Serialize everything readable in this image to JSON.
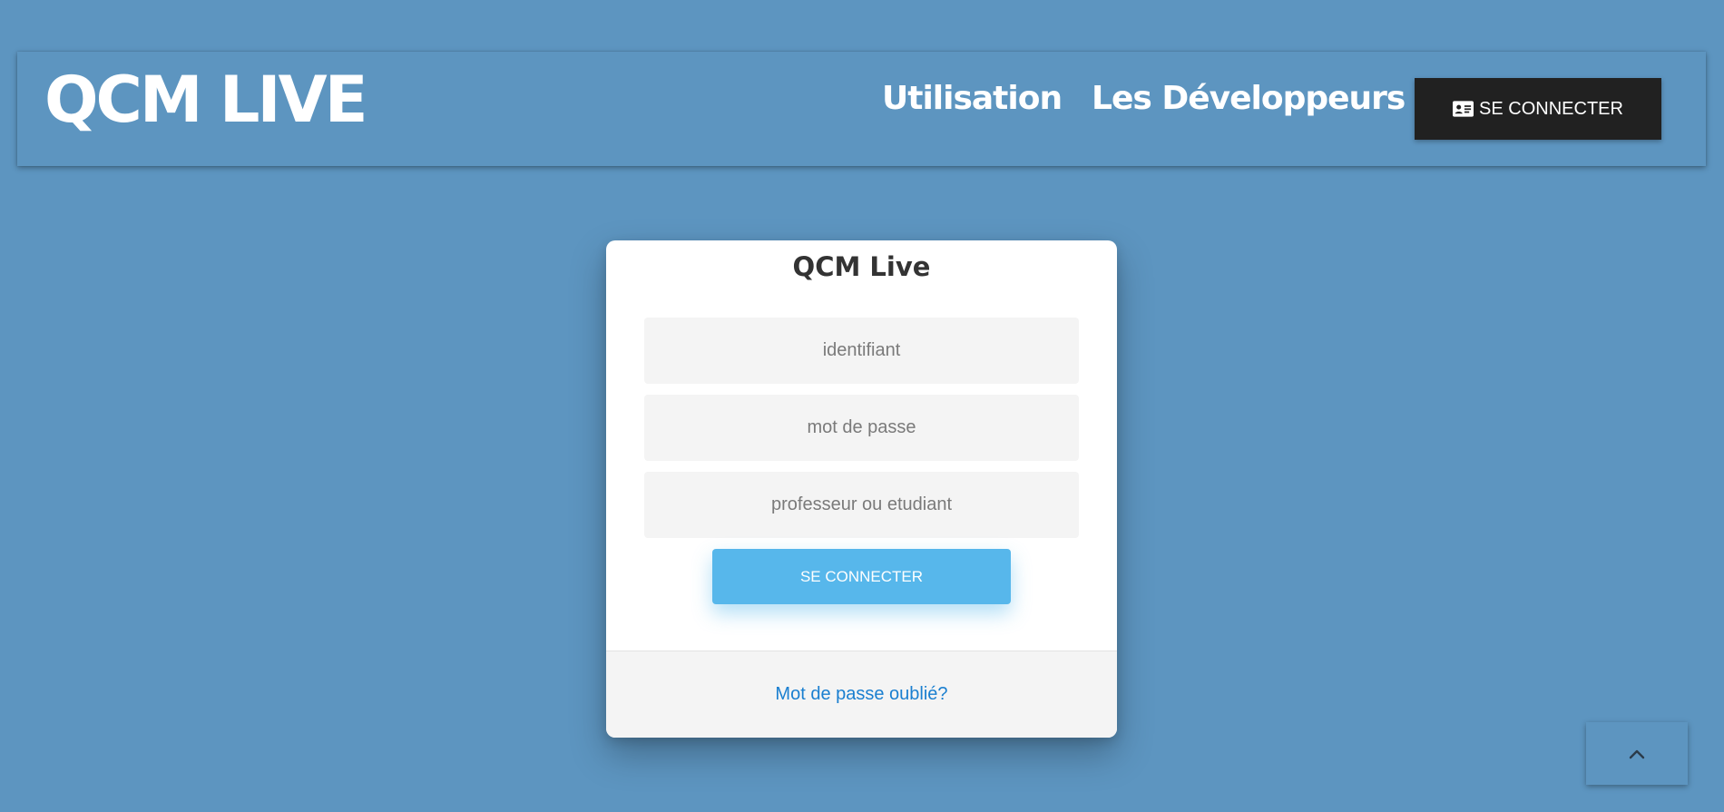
{
  "header": {
    "brand": "QCM LIVE",
    "nav": [
      {
        "label": "Utilisation"
      },
      {
        "label": "Les Développeurs"
      }
    ],
    "login_button": {
      "icon": "id-card-icon",
      "label": "SE CONNECTER"
    }
  },
  "login_card": {
    "title": "QCM Live",
    "fields": {
      "identifier_placeholder": "identifiant",
      "password_placeholder": "mot de passe",
      "role_placeholder": "professeur ou etudiant"
    },
    "submit_label": "SE CONNECTER",
    "forgot_link": "Mot de passe oublié?"
  },
  "back_to_top": {
    "icon": "chevron-up-icon"
  },
  "colors": {
    "background": "#5d95c0",
    "login_button_bg": "#212121",
    "submit_bg": "#57b7eb",
    "link": "#1a7fd0"
  }
}
